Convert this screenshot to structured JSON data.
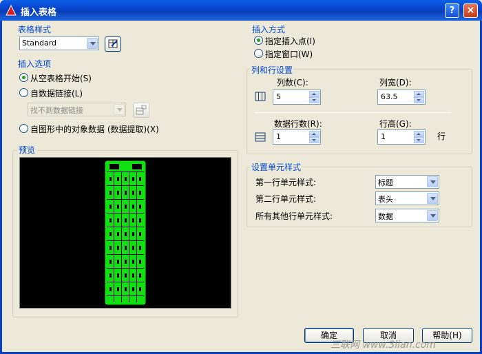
{
  "window": {
    "title": "插入表格",
    "help_btn": "?",
    "close_btn": "×"
  },
  "table_style": {
    "legend": "表格样式",
    "value": "Standard"
  },
  "insert_options": {
    "legend": "插入选项",
    "opt_empty": "从空表格开始(S)",
    "opt_datalink": "自数据链接(L)",
    "datalink_value": "找不到数据链接",
    "opt_extract": "自图形中的对象数据 (数据提取)(X)"
  },
  "preview": {
    "legend": "预览"
  },
  "insert_method": {
    "legend": "插入方式",
    "opt_point": "指定插入点(I)",
    "opt_window": "指定窗口(W)"
  },
  "col_row": {
    "legend": "列和行设置",
    "cols_label": "列数(C):",
    "cols_value": "5",
    "colwidth_label": "列宽(D):",
    "colwidth_value": "63.5",
    "rows_label": "数据行数(R):",
    "rows_value": "1",
    "rowheight_label": "行高(G):",
    "rowheight_value": "1",
    "row_unit": "行"
  },
  "cell_styles": {
    "legend": "设置单元样式",
    "first_label": "第一行单元样式:",
    "first_value": "标题",
    "second_label": "第二行单元样式:",
    "second_value": "表头",
    "others_label": "所有其他行单元样式:",
    "others_value": "数据"
  },
  "buttons": {
    "ok": "确定",
    "cancel": "取消",
    "help": "帮助(H)"
  },
  "watermark": "三联网 www.3lian.com"
}
